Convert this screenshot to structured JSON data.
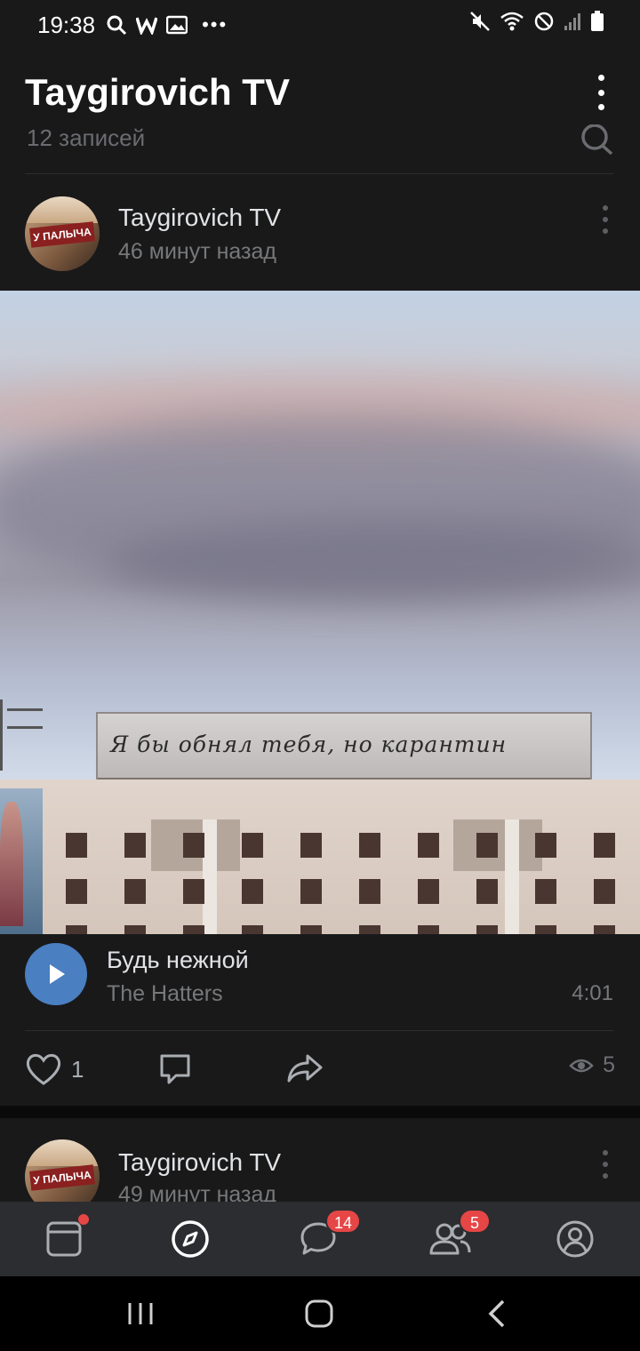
{
  "status_bar": {
    "time": "19:38",
    "left_icons": [
      "search-icon",
      "w-app-icon",
      "gallery-icon",
      "more-dots-icon"
    ],
    "right_icons": [
      "mute-icon",
      "wifi-icon",
      "do-not-disturb-icon",
      "signal-icon",
      "battery-icon"
    ]
  },
  "header": {
    "title": "Taygirovich TV",
    "more_icon": "more-vertical-icon"
  },
  "subheader": {
    "records_count": "12 записей",
    "search_icon": "search-icon"
  },
  "post": {
    "author": "Taygirovich TV",
    "time": "46 минут назад",
    "avatar_text": "У ПАЛЫЧА",
    "photo_sign_text": "Я бы обнял тебя, но карантин",
    "audio": {
      "title": "Будь нежной",
      "artist": "The Hatters",
      "duration": "4:01"
    },
    "likes": "1",
    "views": "5"
  },
  "post2": {
    "author": "Taygirovich TV",
    "time": "49 минут назад",
    "avatar_text": "У ПАЛЫЧА"
  },
  "tabbar": {
    "messages_badge": "14",
    "friends_badge": "5"
  },
  "colors": {
    "background": "#19191a",
    "accent_blue": "#4a7fc1",
    "badge_red": "#e64646",
    "tabbar": "#2c2d30"
  }
}
